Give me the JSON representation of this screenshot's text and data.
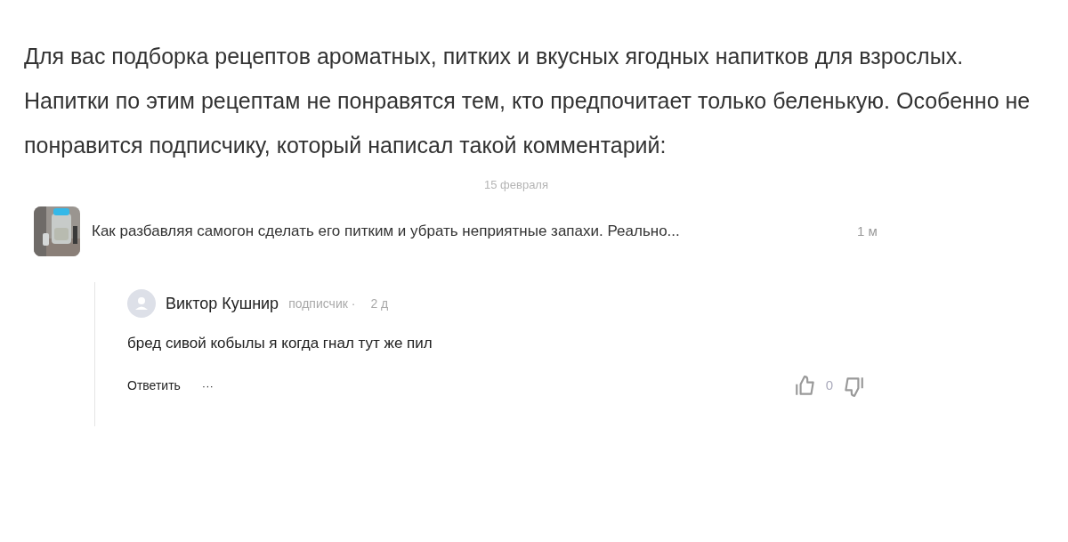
{
  "intro": "Для вас подборка рецептов ароматных, питких и вкусных ягодных напитков для взрослых. Напитки по этим рецептам не понравятся тем, кто предпочитает только беленькую. Особенно не понравится подписчику, который написал такой комментарий:",
  "date": "15 февраля",
  "post": {
    "kind": "picture",
    "title": "Как разбавляя самогон сделать его питким и убрать неприятные запахи. Реально...",
    "time": "1 м"
  },
  "reply": {
    "author": "Виктор Кушнир",
    "role": "подписчик ·",
    "time": "2 д",
    "text": "бред сивой кобылы я когда гнал тут же пил",
    "reply_label": "Ответить",
    "more": "···",
    "likes": "0"
  }
}
